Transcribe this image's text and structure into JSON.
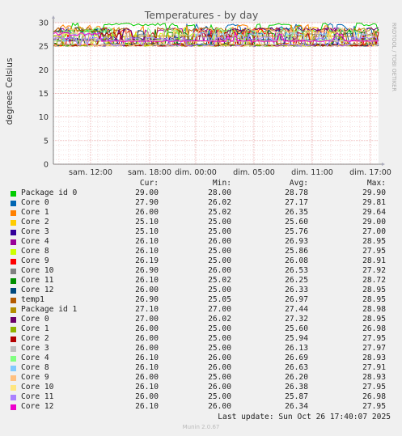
{
  "chart_data": {
    "type": "line",
    "title": "Temperatures - by day",
    "ylabel": "degrees Celsius",
    "side_label": "RRDTOOL / TOBI OETIKER",
    "ylim": [
      0,
      30
    ],
    "y_ticks": [
      "0",
      "5",
      "10",
      "15",
      "20",
      "25",
      "30"
    ],
    "x_ticks": [
      "sam. 12:00",
      "sam. 18:00",
      "dim. 00:00",
      "dim. 05:00",
      "dim. 11:00",
      "dim. 17:00"
    ],
    "grid": true,
    "columns": {
      "cur": "Cur:",
      "min": "Min:",
      "avg": "Avg:",
      "max": "Max:"
    },
    "series": [
      {
        "name": "Package id 0",
        "color": "#00cc00",
        "cur": "29.00",
        "min": "28.00",
        "avg": "28.78",
        "max": "29.90"
      },
      {
        "name": "Core 0",
        "color": "#0066b3",
        "cur": "27.90",
        "min": "26.02",
        "avg": "27.17",
        "max": "29.81"
      },
      {
        "name": "Core 1",
        "color": "#ff8000",
        "cur": "26.00",
        "min": "25.02",
        "avg": "26.35",
        "max": "29.64"
      },
      {
        "name": "Core 2",
        "color": "#ffcc00",
        "cur": "25.10",
        "min": "25.00",
        "avg": "25.60",
        "max": "29.00"
      },
      {
        "name": "Core 3",
        "color": "#330099",
        "cur": "25.10",
        "min": "25.00",
        "avg": "25.76",
        "max": "27.00"
      },
      {
        "name": "Core 4",
        "color": "#990099",
        "cur": "26.10",
        "min": "26.00",
        "avg": "26.93",
        "max": "28.95"
      },
      {
        "name": "Core 8",
        "color": "#ccff00",
        "cur": "26.10",
        "min": "25.00",
        "avg": "25.86",
        "max": "27.95"
      },
      {
        "name": "Core 9",
        "color": "#ff0000",
        "cur": "26.19",
        "min": "25.00",
        "avg": "26.08",
        "max": "28.91"
      },
      {
        "name": "Core 10",
        "color": "#808080",
        "cur": "26.90",
        "min": "26.00",
        "avg": "26.53",
        "max": "27.92"
      },
      {
        "name": "Core 11",
        "color": "#008f00",
        "cur": "26.10",
        "min": "25.02",
        "avg": "26.25",
        "max": "28.72"
      },
      {
        "name": "Core 12",
        "color": "#00487d",
        "cur": "26.00",
        "min": "25.00",
        "avg": "26.33",
        "max": "28.95"
      },
      {
        "name": "temp1",
        "color": "#b35a00",
        "cur": "26.90",
        "min": "25.05",
        "avg": "26.97",
        "max": "28.95"
      },
      {
        "name": "Package id 1",
        "color": "#b38f00",
        "cur": "27.10",
        "min": "27.00",
        "avg": "27.44",
        "max": "28.98"
      },
      {
        "name": "Core 0",
        "color": "#6b006b",
        "cur": "27.00",
        "min": "26.02",
        "avg": "27.32",
        "max": "28.95"
      },
      {
        "name": "Core 1",
        "color": "#8fb300",
        "cur": "26.00",
        "min": "25.00",
        "avg": "25.60",
        "max": "26.98"
      },
      {
        "name": "Core 2",
        "color": "#b30000",
        "cur": "26.00",
        "min": "25.00",
        "avg": "25.94",
        "max": "27.95"
      },
      {
        "name": "Core 3",
        "color": "#bebebe",
        "cur": "26.00",
        "min": "25.00",
        "avg": "26.13",
        "max": "27.97"
      },
      {
        "name": "Core 4",
        "color": "#80ff80",
        "cur": "26.10",
        "min": "26.00",
        "avg": "26.69",
        "max": "28.93"
      },
      {
        "name": "Core 8",
        "color": "#80c9ff",
        "cur": "26.10",
        "min": "26.00",
        "avg": "26.63",
        "max": "27.91"
      },
      {
        "name": "Core 9",
        "color": "#ffc080",
        "cur": "26.00",
        "min": "25.00",
        "avg": "26.20",
        "max": "28.93"
      },
      {
        "name": "Core 10",
        "color": "#ffe680",
        "cur": "26.10",
        "min": "26.00",
        "avg": "26.38",
        "max": "27.95"
      },
      {
        "name": "Core 11",
        "color": "#aa80ff",
        "cur": "26.00",
        "min": "25.00",
        "avg": "25.87",
        "max": "26.98"
      },
      {
        "name": "Core 12",
        "color": "#ee00cc",
        "cur": "26.10",
        "min": "26.00",
        "avg": "26.34",
        "max": "27.95"
      }
    ]
  },
  "last_update": "Last update: Sun Oct 26 17:40:07 2025",
  "footer": "Munin 2.0.67"
}
